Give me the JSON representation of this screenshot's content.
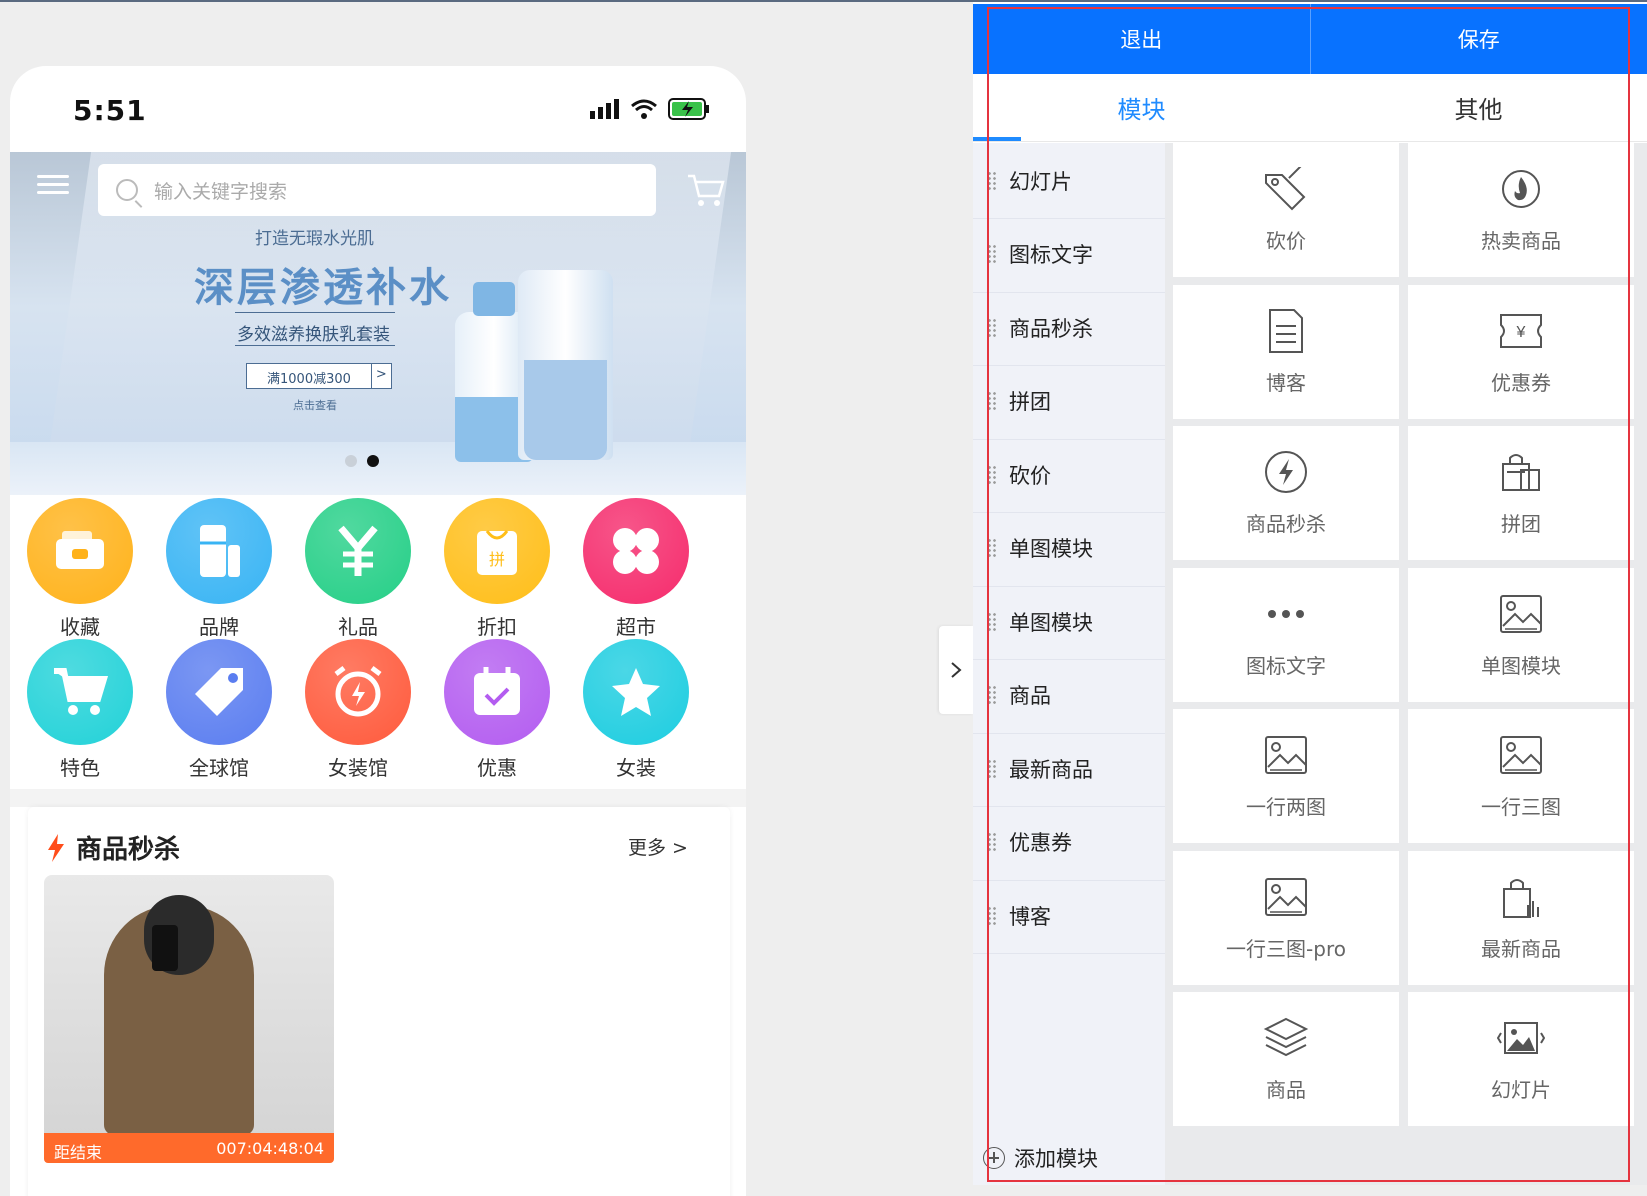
{
  "phone": {
    "status": {
      "time": "5:51"
    },
    "search": {
      "placeholder": "输入关键字搜索"
    },
    "banner": {
      "subtitle": "打造无瑕水光肌",
      "title": "深层渗透补水",
      "tagline": "多效滋养换肤乳套装",
      "promo": "满1000减300",
      "promo_arrow": ">",
      "cta": "点击查看"
    },
    "categories": [
      {
        "label": "收藏",
        "icon": "wallet-icon",
        "color": "#ffb21a"
      },
      {
        "label": "品牌",
        "icon": "fridge-icon",
        "color": "#38b4f4"
      },
      {
        "label": "礼品",
        "icon": "yen-icon",
        "color": "#25cf87"
      },
      {
        "label": "折扣",
        "icon": "bag-icon",
        "color": "#ffbe18"
      },
      {
        "label": "超市",
        "icon": "clover-icon",
        "color": "#f52b6c"
      },
      {
        "label": "特色",
        "icon": "cart-icon",
        "color": "#22d2d8"
      },
      {
        "label": "全球馆",
        "icon": "tag-icon",
        "color": "#5a7df0"
      },
      {
        "label": "女装馆",
        "icon": "alarm-icon",
        "color": "#ff5a3c"
      },
      {
        "label": "优惠",
        "icon": "calendar-icon",
        "color": "#b35cf0"
      },
      {
        "label": "女装",
        "icon": "star-icon",
        "color": "#1dcde0"
      }
    ],
    "flash_sale": {
      "title": "商品秒杀",
      "more": "更多 >",
      "product_status": "距结束",
      "product_timer": "007:04:48:04"
    }
  },
  "panel": {
    "exit_label": "退出",
    "save_label": "保存",
    "tabs": [
      "模块",
      "其他"
    ],
    "active_tab": "模块",
    "side_items": [
      "幻灯片",
      "图标文字",
      "商品秒杀",
      "拼团",
      "砍价",
      "单图模块",
      "单图模块",
      "商品",
      "最新商品",
      "优惠券",
      "博客"
    ],
    "add_module": "添加模块",
    "modules": [
      {
        "label": "砍价",
        "icon": "bargain-tag-icon"
      },
      {
        "label": "热卖商品",
        "icon": "flame-icon"
      },
      {
        "label": "博客",
        "icon": "document-icon"
      },
      {
        "label": "优惠券",
        "icon": "coupon-icon"
      },
      {
        "label": "商品秒杀",
        "icon": "lightning-icon"
      },
      {
        "label": "拼团",
        "icon": "shopping-bags-icon"
      },
      {
        "label": "图标文字",
        "icon": "more-dots-icon"
      },
      {
        "label": "单图模块",
        "icon": "image-icon"
      },
      {
        "label": "一行两图",
        "icon": "image-icon"
      },
      {
        "label": "一行三图",
        "icon": "image-icon"
      },
      {
        "label": "一行三图-pro",
        "icon": "image-icon"
      },
      {
        "label": "最新商品",
        "icon": "new-bag-icon"
      },
      {
        "label": "商品",
        "icon": "layers-icon"
      },
      {
        "label": "幻灯片",
        "icon": "slideshow-icon"
      }
    ]
  },
  "colors": {
    "primary": "#0872ff",
    "accent": "#1f8bff",
    "highlight_border": "#e5343f"
  }
}
